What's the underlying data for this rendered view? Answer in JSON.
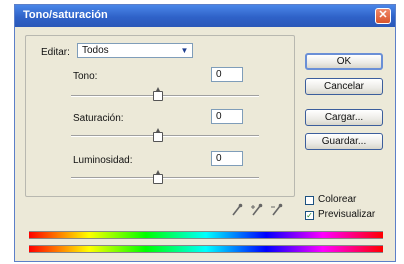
{
  "window": {
    "title": "Tono/saturación",
    "close_glyph": "✕"
  },
  "edit": {
    "label": "Editar:",
    "value": "Todos"
  },
  "sliders": {
    "hue": {
      "label": "Tono:",
      "value": "0"
    },
    "saturation": {
      "label": "Saturación:",
      "value": "0"
    },
    "lightness": {
      "label": "Luminosidad:",
      "value": "0"
    }
  },
  "buttons": {
    "ok": "OK",
    "cancel": "Cancelar",
    "load": "Cargar...",
    "save": "Guardar..."
  },
  "checkboxes": {
    "colorize": {
      "label": "Colorear",
      "checked": false
    },
    "preview": {
      "label": "Previsualizar",
      "checked": true
    }
  },
  "icons": [
    "eyedropper-icon",
    "eyedropper-plus-icon",
    "eyedropper-minus-icon"
  ]
}
